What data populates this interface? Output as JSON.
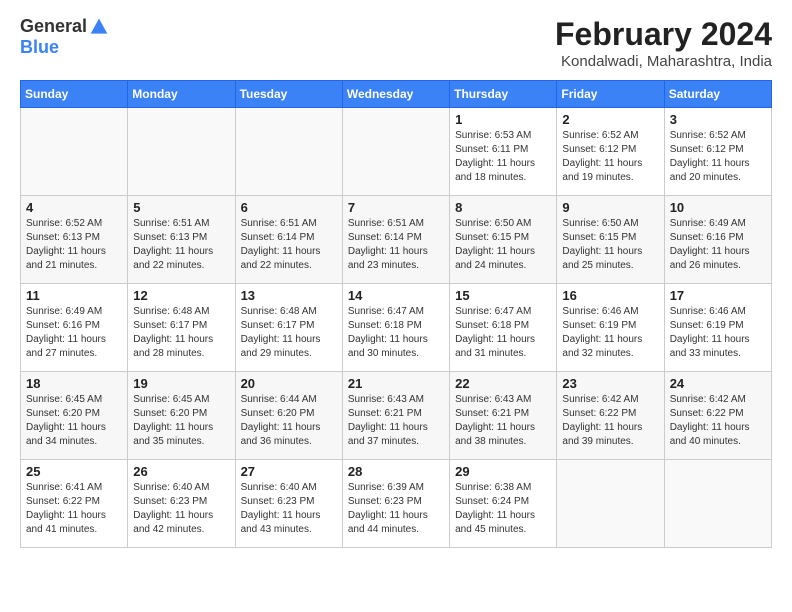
{
  "header": {
    "logo_general": "General",
    "logo_blue": "Blue",
    "month_year": "February 2024",
    "location": "Kondalwadi, Maharashtra, India"
  },
  "days_of_week": [
    "Sunday",
    "Monday",
    "Tuesday",
    "Wednesday",
    "Thursday",
    "Friday",
    "Saturday"
  ],
  "weeks": [
    [
      {
        "day": "",
        "info": ""
      },
      {
        "day": "",
        "info": ""
      },
      {
        "day": "",
        "info": ""
      },
      {
        "day": "",
        "info": ""
      },
      {
        "day": "1",
        "info": "Sunrise: 6:53 AM\nSunset: 6:11 PM\nDaylight: 11 hours and 18 minutes."
      },
      {
        "day": "2",
        "info": "Sunrise: 6:52 AM\nSunset: 6:12 PM\nDaylight: 11 hours and 19 minutes."
      },
      {
        "day": "3",
        "info": "Sunrise: 6:52 AM\nSunset: 6:12 PM\nDaylight: 11 hours and 20 minutes."
      }
    ],
    [
      {
        "day": "4",
        "info": "Sunrise: 6:52 AM\nSunset: 6:13 PM\nDaylight: 11 hours and 21 minutes."
      },
      {
        "day": "5",
        "info": "Sunrise: 6:51 AM\nSunset: 6:13 PM\nDaylight: 11 hours and 22 minutes."
      },
      {
        "day": "6",
        "info": "Sunrise: 6:51 AM\nSunset: 6:14 PM\nDaylight: 11 hours and 22 minutes."
      },
      {
        "day": "7",
        "info": "Sunrise: 6:51 AM\nSunset: 6:14 PM\nDaylight: 11 hours and 23 minutes."
      },
      {
        "day": "8",
        "info": "Sunrise: 6:50 AM\nSunset: 6:15 PM\nDaylight: 11 hours and 24 minutes."
      },
      {
        "day": "9",
        "info": "Sunrise: 6:50 AM\nSunset: 6:15 PM\nDaylight: 11 hours and 25 minutes."
      },
      {
        "day": "10",
        "info": "Sunrise: 6:49 AM\nSunset: 6:16 PM\nDaylight: 11 hours and 26 minutes."
      }
    ],
    [
      {
        "day": "11",
        "info": "Sunrise: 6:49 AM\nSunset: 6:16 PM\nDaylight: 11 hours and 27 minutes."
      },
      {
        "day": "12",
        "info": "Sunrise: 6:48 AM\nSunset: 6:17 PM\nDaylight: 11 hours and 28 minutes."
      },
      {
        "day": "13",
        "info": "Sunrise: 6:48 AM\nSunset: 6:17 PM\nDaylight: 11 hours and 29 minutes."
      },
      {
        "day": "14",
        "info": "Sunrise: 6:47 AM\nSunset: 6:18 PM\nDaylight: 11 hours and 30 minutes."
      },
      {
        "day": "15",
        "info": "Sunrise: 6:47 AM\nSunset: 6:18 PM\nDaylight: 11 hours and 31 minutes."
      },
      {
        "day": "16",
        "info": "Sunrise: 6:46 AM\nSunset: 6:19 PM\nDaylight: 11 hours and 32 minutes."
      },
      {
        "day": "17",
        "info": "Sunrise: 6:46 AM\nSunset: 6:19 PM\nDaylight: 11 hours and 33 minutes."
      }
    ],
    [
      {
        "day": "18",
        "info": "Sunrise: 6:45 AM\nSunset: 6:20 PM\nDaylight: 11 hours and 34 minutes."
      },
      {
        "day": "19",
        "info": "Sunrise: 6:45 AM\nSunset: 6:20 PM\nDaylight: 11 hours and 35 minutes."
      },
      {
        "day": "20",
        "info": "Sunrise: 6:44 AM\nSunset: 6:20 PM\nDaylight: 11 hours and 36 minutes."
      },
      {
        "day": "21",
        "info": "Sunrise: 6:43 AM\nSunset: 6:21 PM\nDaylight: 11 hours and 37 minutes."
      },
      {
        "day": "22",
        "info": "Sunrise: 6:43 AM\nSunset: 6:21 PM\nDaylight: 11 hours and 38 minutes."
      },
      {
        "day": "23",
        "info": "Sunrise: 6:42 AM\nSunset: 6:22 PM\nDaylight: 11 hours and 39 minutes."
      },
      {
        "day": "24",
        "info": "Sunrise: 6:42 AM\nSunset: 6:22 PM\nDaylight: 11 hours and 40 minutes."
      }
    ],
    [
      {
        "day": "25",
        "info": "Sunrise: 6:41 AM\nSunset: 6:22 PM\nDaylight: 11 hours and 41 minutes."
      },
      {
        "day": "26",
        "info": "Sunrise: 6:40 AM\nSunset: 6:23 PM\nDaylight: 11 hours and 42 minutes."
      },
      {
        "day": "27",
        "info": "Sunrise: 6:40 AM\nSunset: 6:23 PM\nDaylight: 11 hours and 43 minutes."
      },
      {
        "day": "28",
        "info": "Sunrise: 6:39 AM\nSunset: 6:23 PM\nDaylight: 11 hours and 44 minutes."
      },
      {
        "day": "29",
        "info": "Sunrise: 6:38 AM\nSunset: 6:24 PM\nDaylight: 11 hours and 45 minutes."
      },
      {
        "day": "",
        "info": ""
      },
      {
        "day": "",
        "info": ""
      }
    ]
  ]
}
